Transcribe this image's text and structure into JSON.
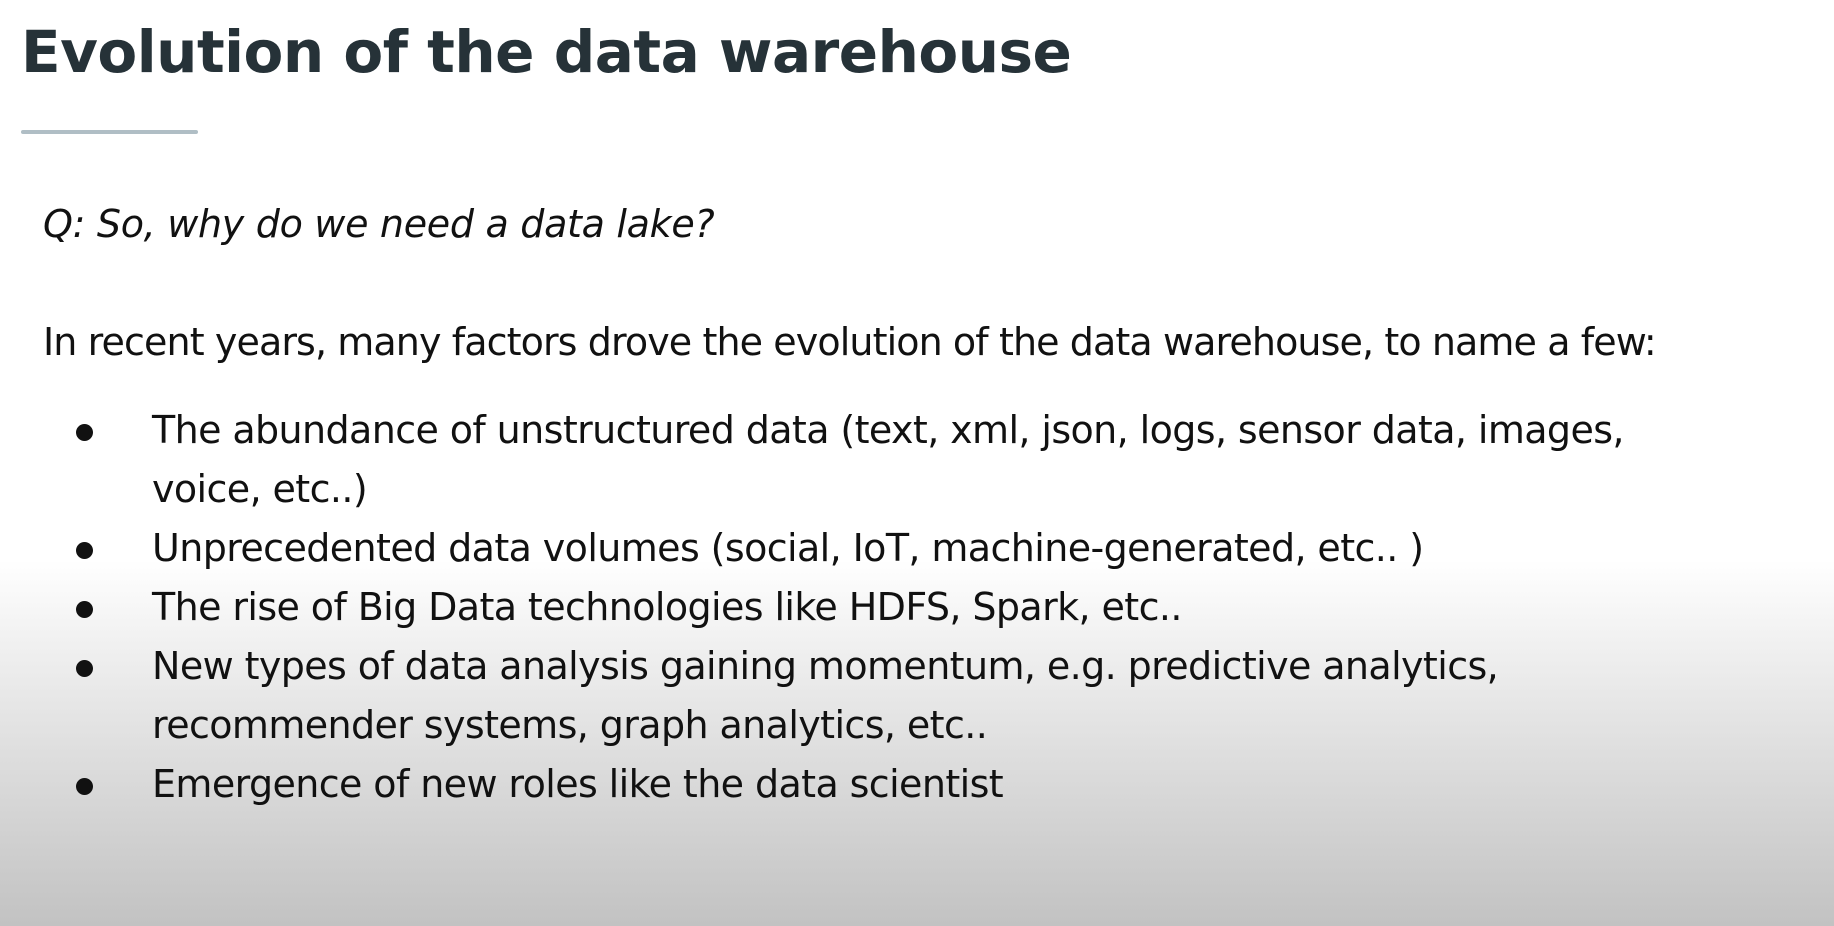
{
  "slide": {
    "title": "Evolution of the data warehouse",
    "question": "Q: So, why do we need a data lake?",
    "intro": "In recent years, many factors drove the evolution of the data warehouse, to name a few:",
    "bullets": [
      "The abundance of unstructured data (text, xml, json, logs, sensor data, images, voice, etc..)",
      "Unprecedented data volumes (social, IoT, machine-generated, etc.. )",
      "The rise of Big Data technologies like HDFS, Spark, etc..",
      "New types of data analysis gaining momentum, e.g. predictive analytics, recommender systems, graph analytics, etc..",
      "Emergence of new roles like the data scientist"
    ]
  },
  "colors": {
    "title": "#263238",
    "title_rule": "#b0bec5",
    "body_text": "#111111"
  }
}
